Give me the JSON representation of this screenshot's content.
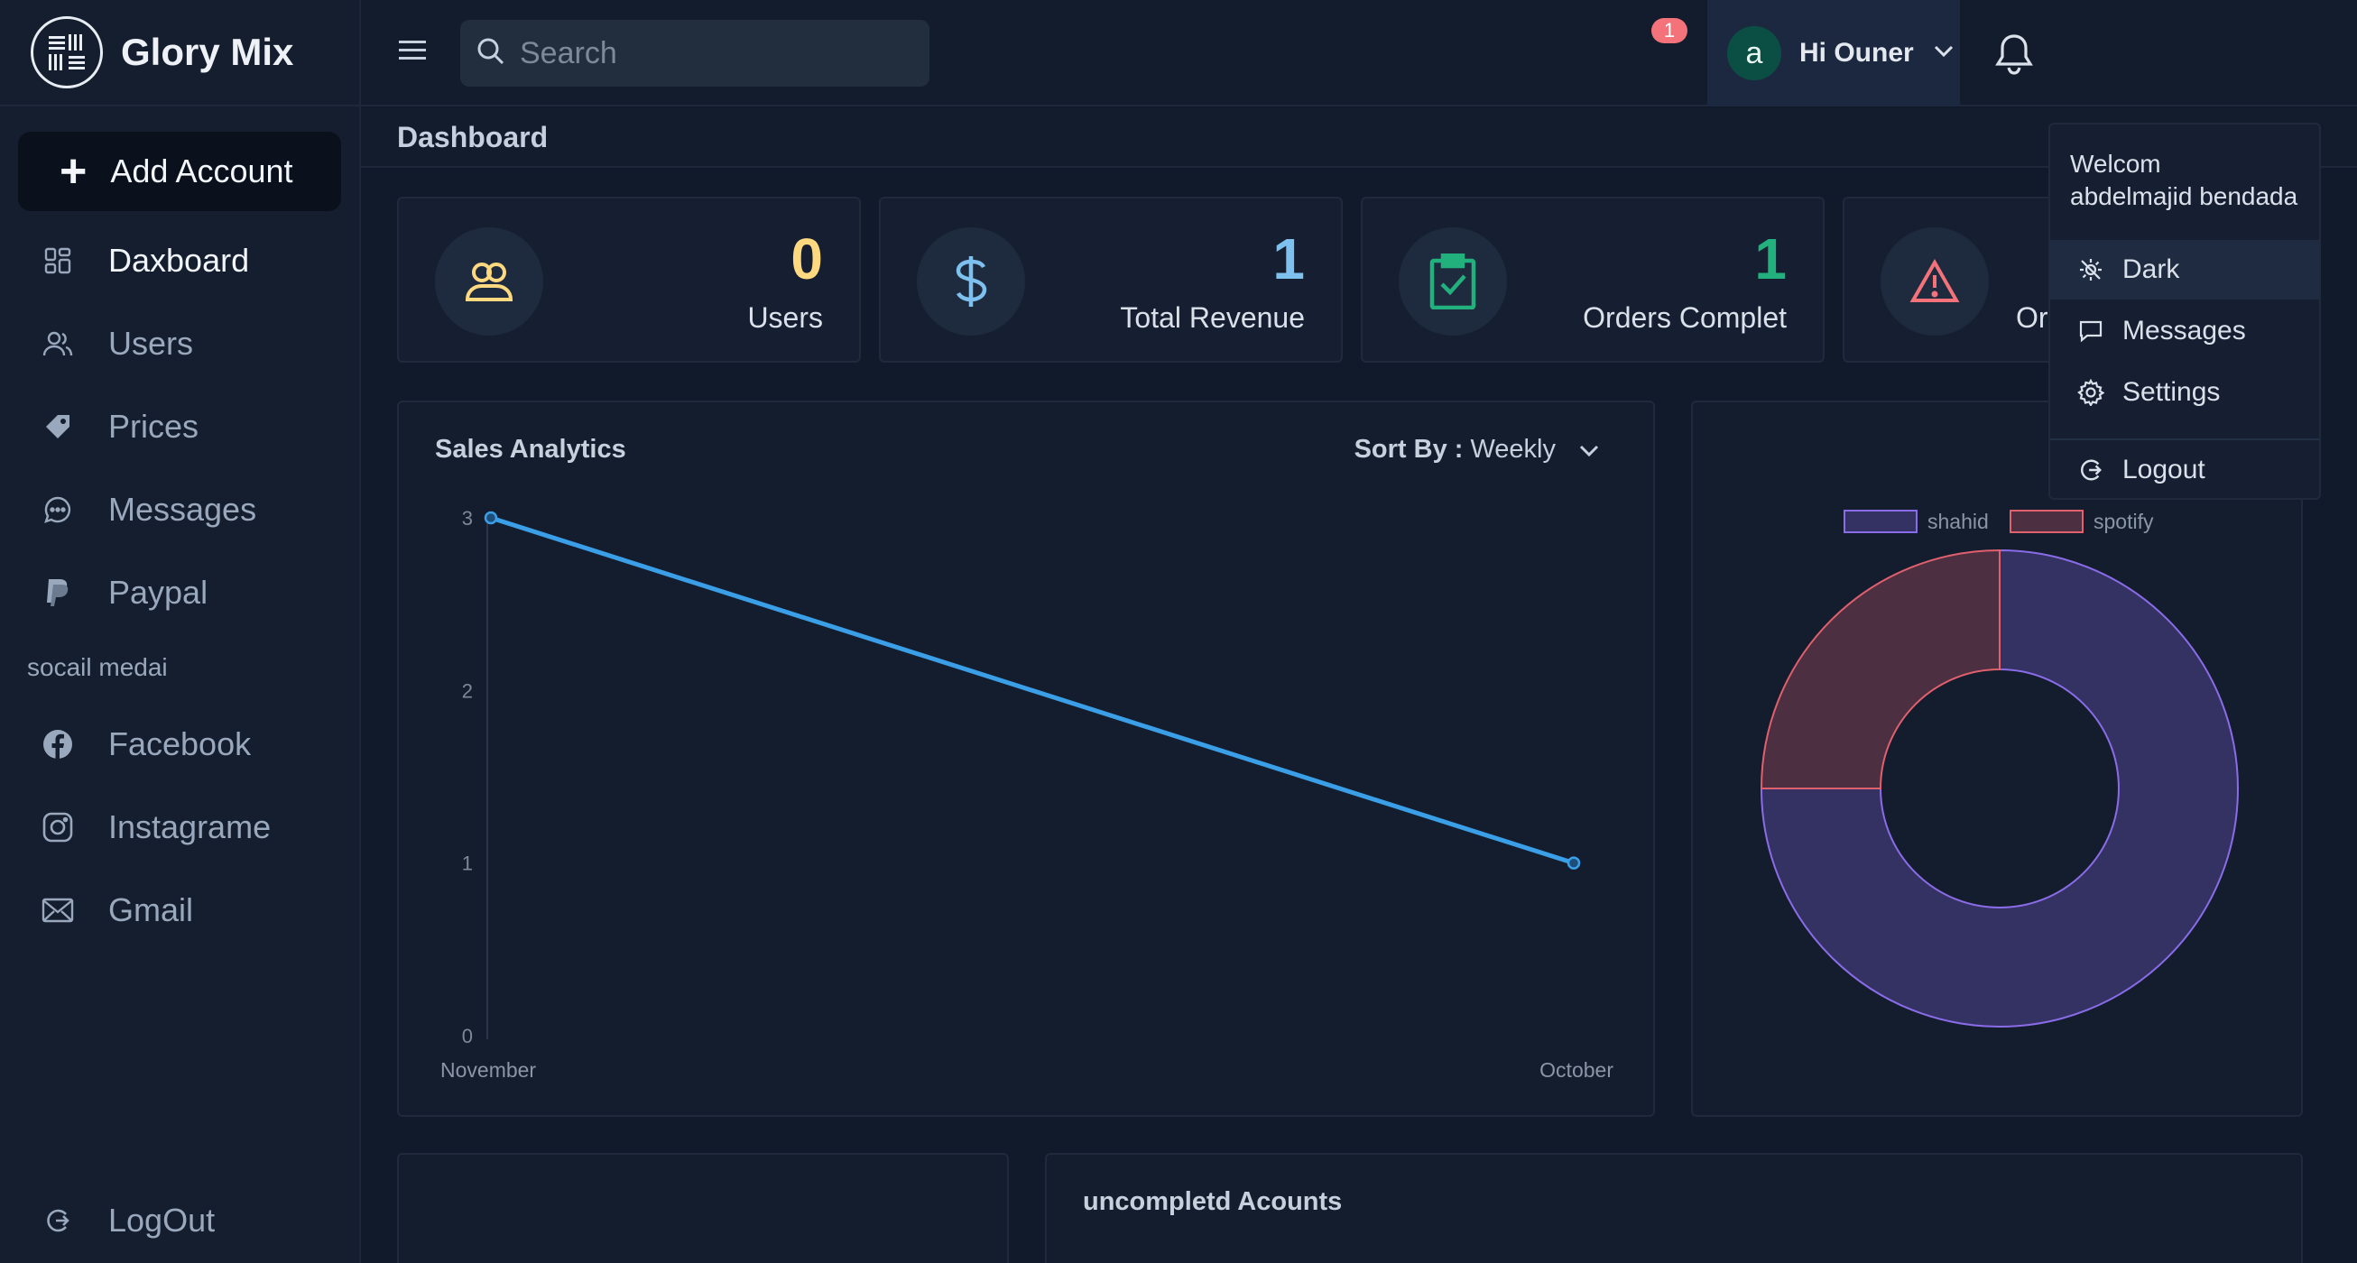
{
  "brand": {
    "name": "Glory Mix"
  },
  "sidebar": {
    "add_button": "Add Account",
    "items": [
      {
        "label": "Daxboard",
        "icon": "dashboard-icon"
      },
      {
        "label": "Users",
        "icon": "users-icon"
      },
      {
        "label": "Prices",
        "icon": "tag-icon"
      },
      {
        "label": "Messages",
        "icon": "chat-icon"
      },
      {
        "label": "Paypal",
        "icon": "paypal-icon"
      }
    ],
    "section_label": "socail medai",
    "social": [
      {
        "label": "Facebook",
        "icon": "facebook-icon"
      },
      {
        "label": "Instagrame",
        "icon": "instagram-icon"
      },
      {
        "label": "Gmail",
        "icon": "mail-icon"
      }
    ],
    "logout": "LogOut"
  },
  "topbar": {
    "search_placeholder": "Search",
    "notification_count": "1",
    "avatar_letter": "a",
    "user_greeting": "Hi Ouner"
  },
  "page": {
    "title": "Dashboard"
  },
  "stats": [
    {
      "value": "0",
      "label": "Users",
      "color": "#ffd980",
      "icon": "users-icon"
    },
    {
      "value": "1",
      "label": "Total Revenue",
      "color": "#7ec1ee",
      "icon": "dollar-icon"
    },
    {
      "value": "1",
      "label": "Orders Complet",
      "color": "#22b07d",
      "icon": "clipboard-check-icon"
    },
    {
      "value": "",
      "label": "Orders",
      "color": "#f4727a",
      "icon": "alert-icon"
    }
  ],
  "sales": {
    "title": "Sales Analytics",
    "sort_label": "Sort By :",
    "sort_value": "Weekly"
  },
  "uncompleted": {
    "title": "uncompletd Acounts"
  },
  "dropdown": {
    "welcome_line1": "Welcom",
    "welcome_line2": "abdelmajid bendada",
    "items": [
      {
        "label": "Dark",
        "icon": "theme-icon"
      },
      {
        "label": "Messages",
        "icon": "message-icon"
      },
      {
        "label": "Settings",
        "icon": "gear-icon"
      }
    ],
    "logout": "Logout"
  },
  "colors": {
    "line": "#3b9fe8",
    "shahid": "#8a6ce8",
    "spotify": "#e0606e"
  },
  "chart_data": [
    {
      "type": "line",
      "categories": [
        "November",
        "October"
      ],
      "series": [
        {
          "values": [
            3,
            1
          ]
        }
      ],
      "ylim": [
        0,
        3
      ],
      "yticks": [
        0,
        1,
        2,
        3
      ],
      "grid": false
    },
    {
      "type": "pie",
      "donut": true,
      "labels": [
        "shahid",
        "spotify"
      ],
      "values": [
        3,
        1
      ],
      "legend": "top"
    }
  ]
}
